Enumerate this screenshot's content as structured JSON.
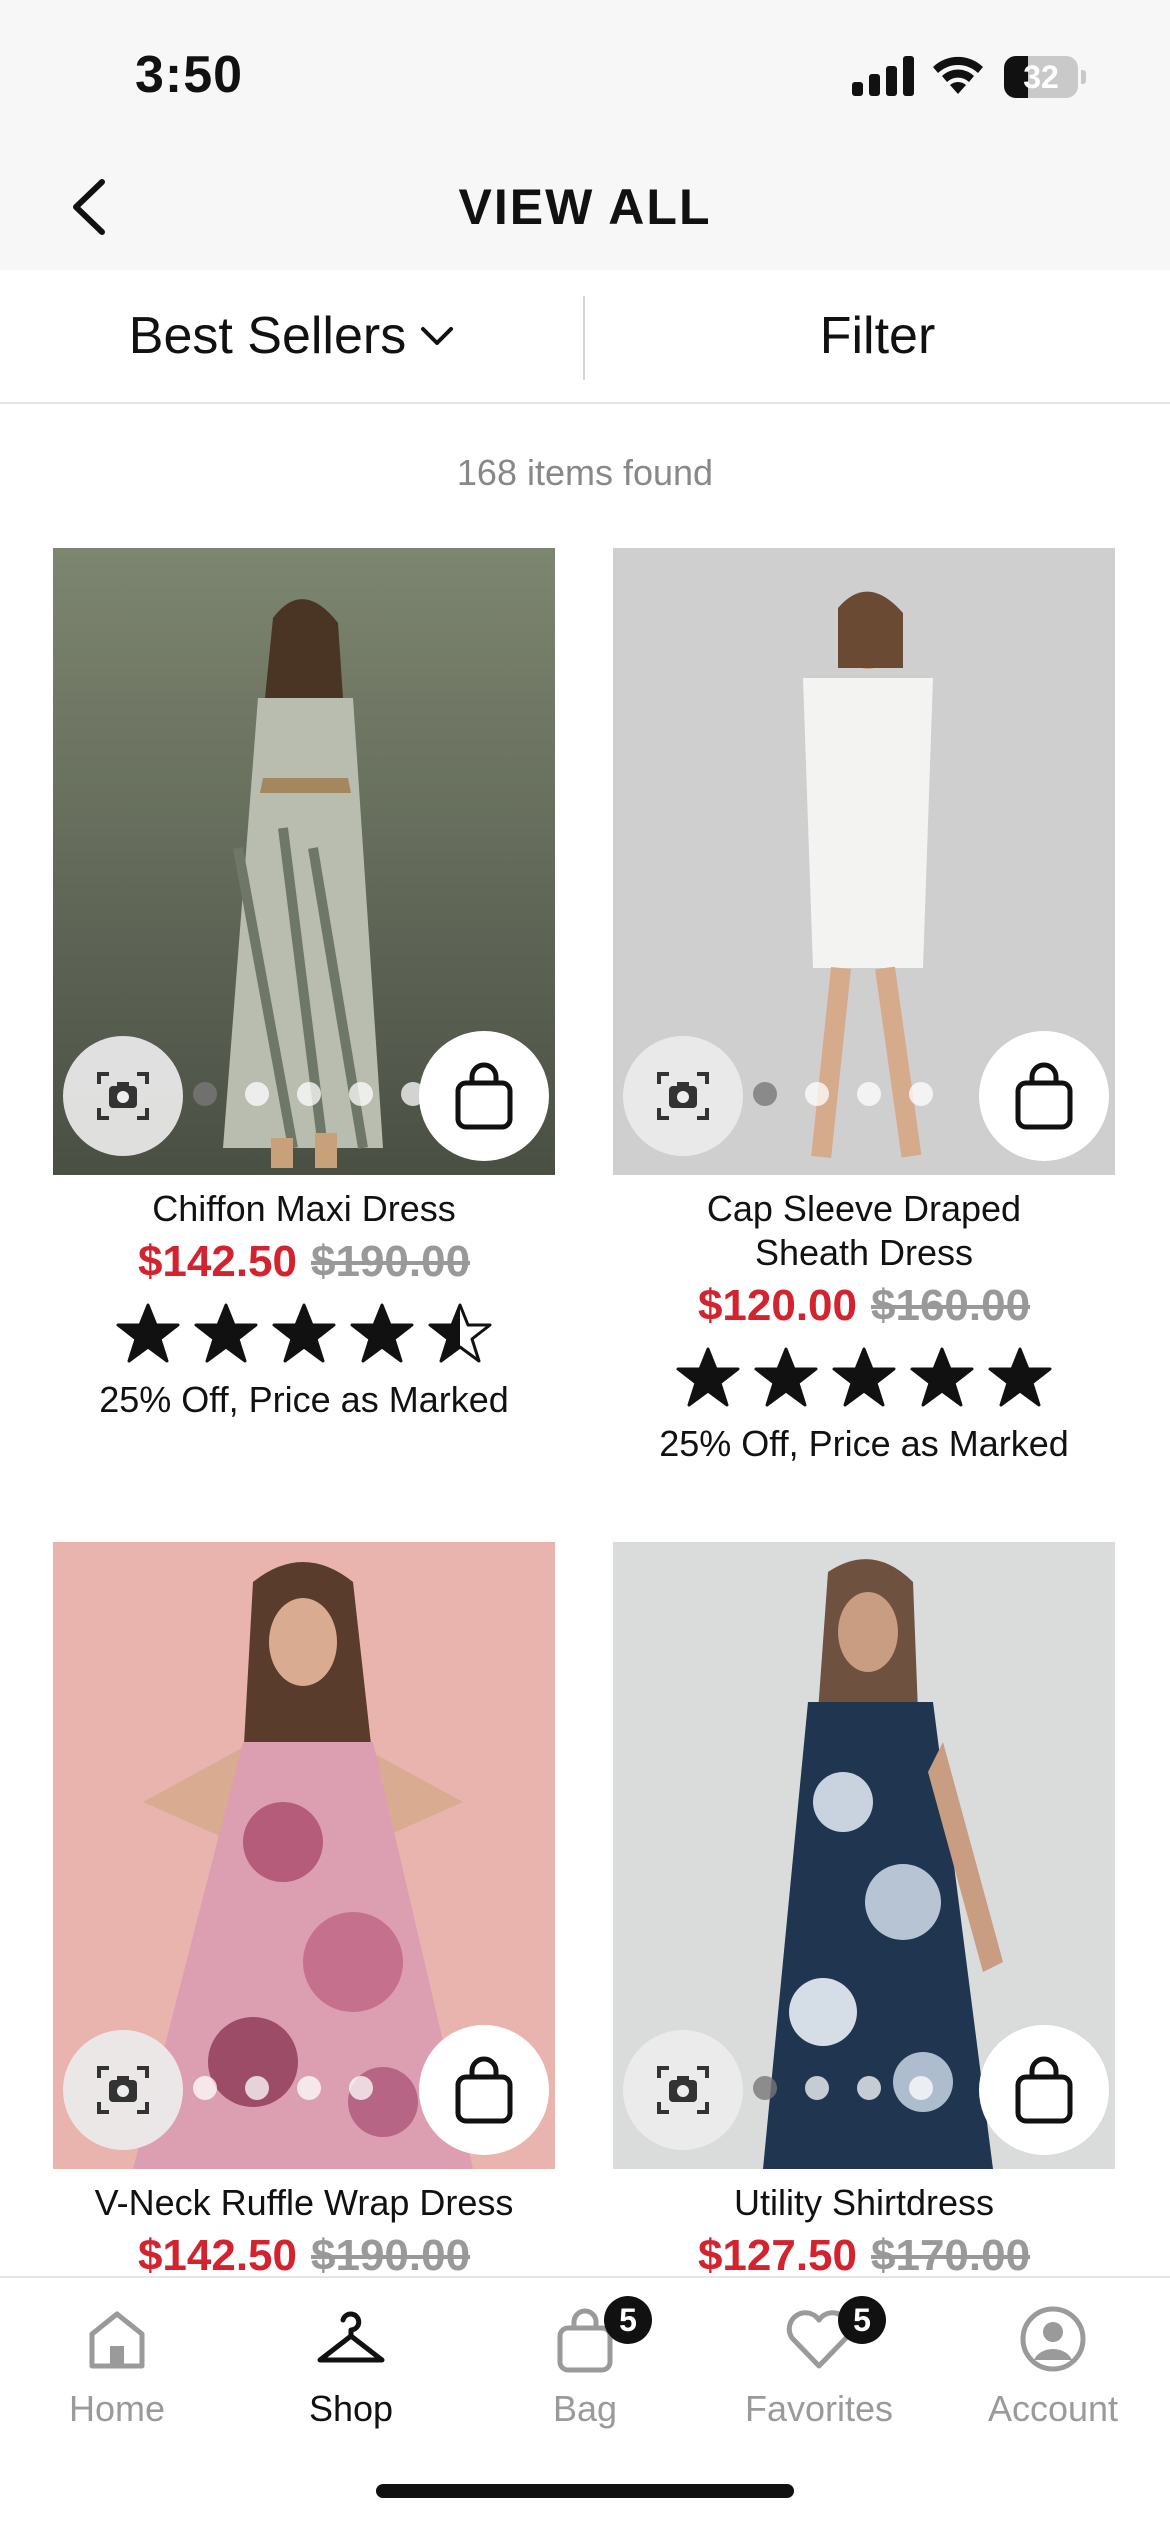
{
  "status_bar": {
    "time": "3:50",
    "battery": "32",
    "battery_level": 0.32
  },
  "header": {
    "title": "VIEW ALL"
  },
  "toolbar": {
    "sort_label": "Best Sellers",
    "filter_label": "Filter"
  },
  "results": {
    "count_text": "168 items found"
  },
  "products": [
    {
      "name": "Chiffon Maxi Dress",
      "sale_price": "$142.50",
      "original_price": "$190.00",
      "rating": 4.5,
      "promo": "25% Off, Price as Marked",
      "image_dots": 5,
      "active_dot": 0
    },
    {
      "name": "Cap Sleeve Draped Sheath Dress",
      "sale_price": "$120.00",
      "original_price": "$160.00",
      "rating": 5,
      "promo": "25% Off, Price as Marked",
      "image_dots": 4,
      "active_dot": 0
    },
    {
      "name": "V-Neck Ruffle Wrap Dress",
      "sale_price": "$142.50",
      "original_price": "$190.00"
    },
    {
      "name": "Utility Shirtdress",
      "sale_price": "$127.50",
      "original_price": "$170.00"
    }
  ],
  "tab_bar": {
    "items": [
      {
        "label": "Home",
        "icon": "home-icon"
      },
      {
        "label": "Shop",
        "icon": "hanger-icon",
        "active": true
      },
      {
        "label": "Bag",
        "icon": "bag-icon",
        "badge": "5"
      },
      {
        "label": "Favorites",
        "icon": "heart-icon",
        "badge": "5"
      },
      {
        "label": "Account",
        "icon": "account-icon"
      }
    ]
  },
  "colors": {
    "sale": "#d3232e",
    "strike": "#999999",
    "header_bg": "#f7f7f7"
  }
}
